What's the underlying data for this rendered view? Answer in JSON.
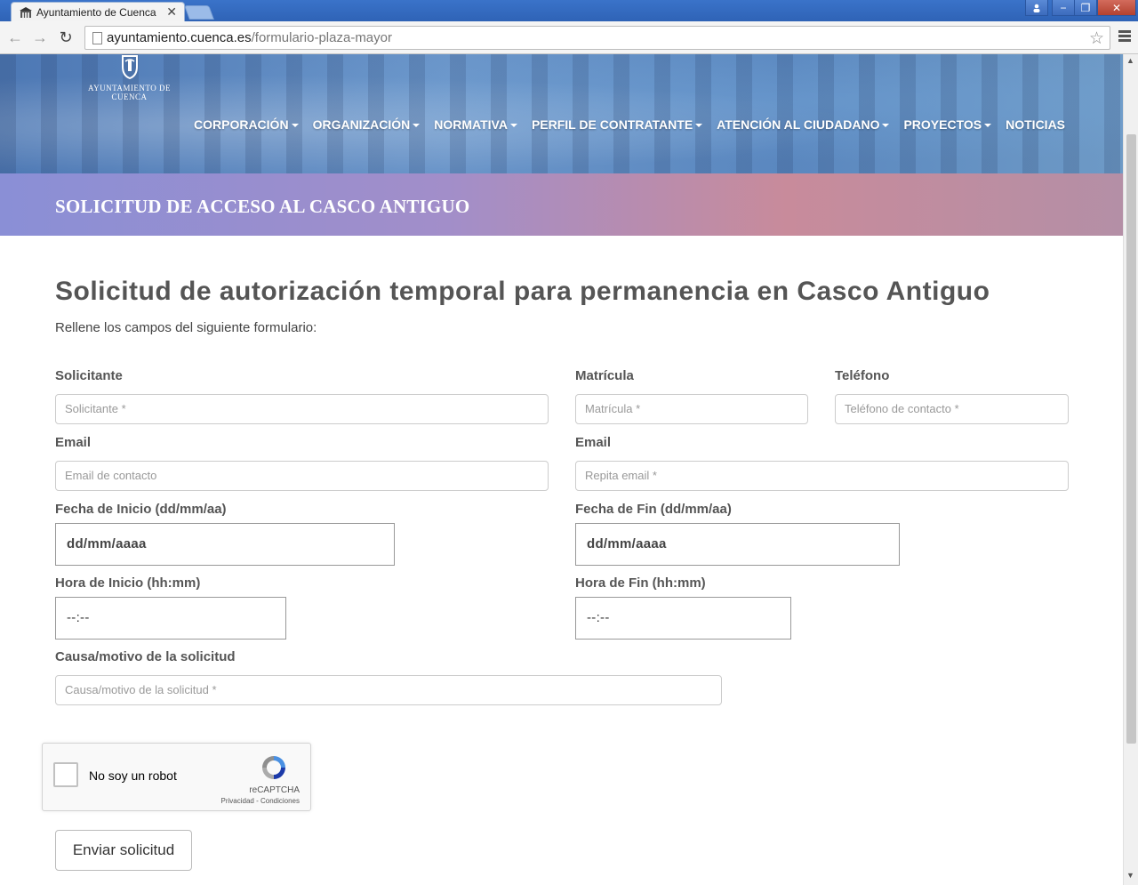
{
  "browser": {
    "tab_title": "Ayuntamiento de Cuenca",
    "tab_close": "✕",
    "url_domain": "ayuntamiento.cuenca.es",
    "url_path": "/formulario-plaza-mayor",
    "back": "←",
    "forward": "→",
    "reload": "↻",
    "star": "☆",
    "min": "−",
    "max": "❐",
    "close": "✕",
    "user": "👤"
  },
  "site": {
    "logo_text": "AYUNTAMIENTO DE CUENCA",
    "nav": [
      {
        "label": "CORPORACIÓN",
        "caret": true
      },
      {
        "label": "ORGANIZACIÓN",
        "caret": true
      },
      {
        "label": "NORMATIVA",
        "caret": true
      },
      {
        "label": "PERFIL DE CONTRATANTE",
        "caret": true
      },
      {
        "label": "ATENCIÓN AL CIUDADANO",
        "caret": true
      },
      {
        "label": "PROYECTOS",
        "caret": true
      },
      {
        "label": "NOTICIAS",
        "caret": false
      }
    ],
    "banner_title": "SOLICITUD DE ACCESO AL CASCO ANTIGUO"
  },
  "form": {
    "heading": "Solicitud de autorización temporal para permanencia en Casco Antiguo",
    "subtext": "Rellene los campos del siguiente formulario:",
    "solicitante_label": "Solicitante",
    "solicitante_placeholder": "Solicitante *",
    "matricula_label": "Matrícula",
    "matricula_placeholder": "Matrícula *",
    "telefono_label": "Teléfono",
    "telefono_placeholder": "Teléfono de contacto *",
    "email_label": "Email",
    "email_placeholder": "Email de contacto",
    "email2_label": "Email",
    "email2_placeholder": "Repita email *",
    "fecha_inicio_label": "Fecha de Inicio (dd/mm/aa)",
    "fecha_inicio_value": "dd/mm/aaaa",
    "fecha_fin_label": "Fecha de Fin (dd/mm/aa)",
    "fecha_fin_value": "dd/mm/aaaa",
    "hora_inicio_label": "Hora de Inicio (hh:mm)",
    "hora_inicio_value": "--:--",
    "hora_fin_label": "Hora de Fin (hh:mm)",
    "hora_fin_value": "--:--",
    "causa_label": "Causa/motivo de la solicitud",
    "causa_placeholder": "Causa/motivo de la solicitud *",
    "recaptcha_label": "No soy un robot",
    "recaptcha_brand": "reCAPTCHA",
    "recaptcha_links": "Privacidad - Condiciones",
    "submit_label": "Enviar solicitud"
  }
}
